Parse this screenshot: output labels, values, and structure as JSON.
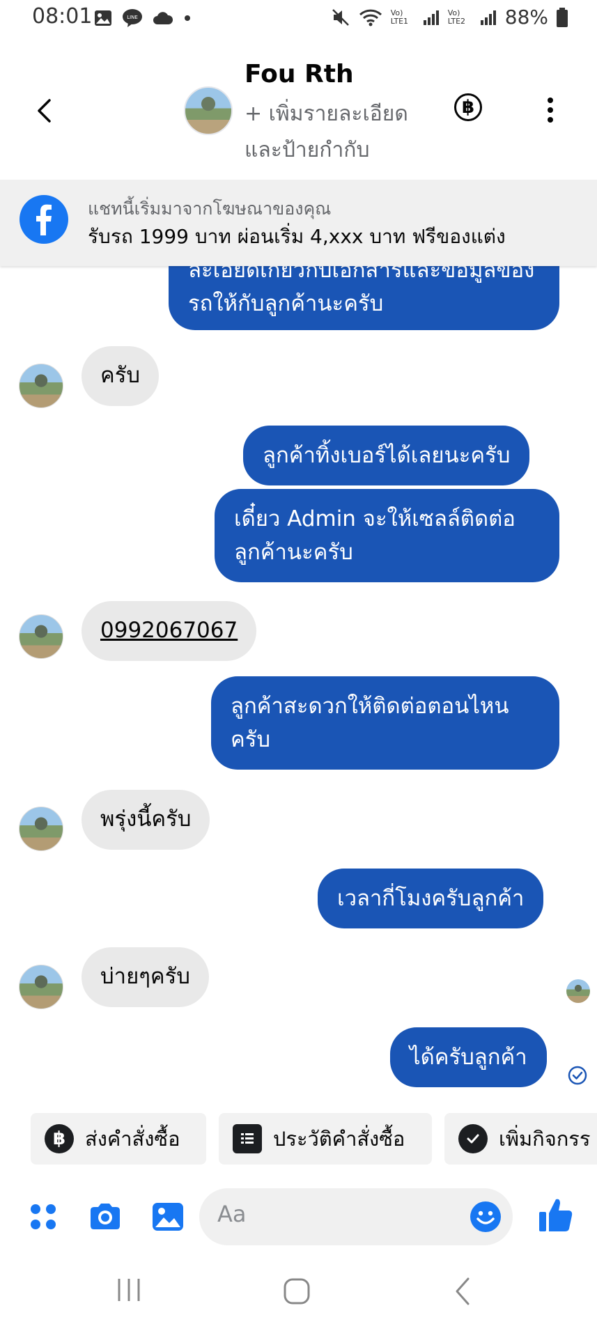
{
  "status_bar": {
    "time": "08:01",
    "sim1": "Vo) LTE1",
    "sim2": "Vo) LTE2",
    "battery": "88%"
  },
  "header": {
    "name": "Fou Rth",
    "subtitle": "+ เพิ่มรายละเอียดและป้ายกำกับ",
    "baht_symbol": "฿"
  },
  "ad_banner": {
    "line1": "แชทนี้เริ่มมาจากโฆษณาของคุณ",
    "line2": "รับรถ 1999 บาท ผ่อนเริ่ม 4,xxx บาท ฟรีของแต่ง"
  },
  "messages": [
    {
      "side": "out",
      "text": "ละเอียดเกี่ยวกับเอกสารและข้อมูลของรถให้กับลูกค้านะครับ"
    },
    {
      "side": "in",
      "text": "ครับ"
    },
    {
      "side": "out",
      "text": "ลูกค้าทิ้งเบอร์ได้เลยนะครับ"
    },
    {
      "side": "out",
      "text": "เดี๋ยว Admin จะให้เซลล์ติดต่อลูกค้านะครับ"
    },
    {
      "side": "in",
      "text": "0992067067"
    },
    {
      "side": "out",
      "text": "ลูกค้าสะดวกให้ติดต่อตอนไหนครับ"
    },
    {
      "side": "in",
      "text": "พรุ่งนี้ครับ"
    },
    {
      "side": "out",
      "text": "เวลากี่โมงครับลูกค้า"
    },
    {
      "side": "in",
      "text": "บ่ายๆครับ"
    },
    {
      "side": "out",
      "text": "ได้ครับลูกค้า"
    }
  ],
  "quick_actions": [
    {
      "label": "ส่งคำสั่งซื้อ",
      "icon": "baht-icon"
    },
    {
      "label": "ประวัติคำสั่งซื้อ",
      "icon": "list-icon"
    },
    {
      "label": "เพิ่มกิจกรร",
      "icon": "check-icon"
    }
  ],
  "composer": {
    "placeholder": "Aa"
  },
  "colors": {
    "outgoing_bubble": "#1a55b5",
    "incoming_bubble": "#e9e9e9",
    "messenger_blue": "#1877f2"
  }
}
